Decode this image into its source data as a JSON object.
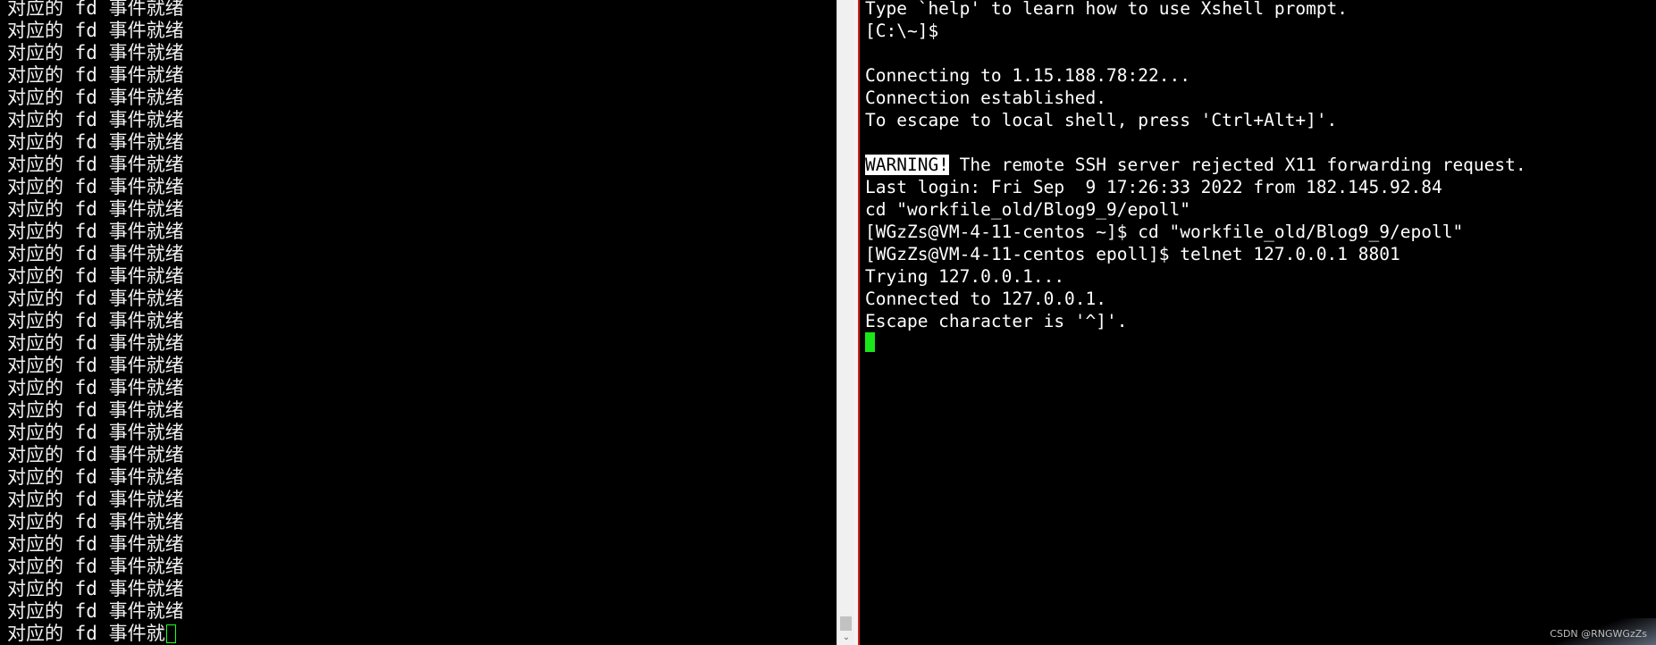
{
  "left_terminal": {
    "lines": [
      "对应的 fd 事件就绪",
      "对应的 fd 事件就绪",
      "对应的 fd 事件就绪",
      "对应的 fd 事件就绪",
      "对应的 fd 事件就绪",
      "对应的 fd 事件就绪",
      "对应的 fd 事件就绪",
      "对应的 fd 事件就绪",
      "对应的 fd 事件就绪",
      "对应的 fd 事件就绪",
      "对应的 fd 事件就绪",
      "对应的 fd 事件就绪",
      "对应的 fd 事件就绪",
      "对应的 fd 事件就绪",
      "对应的 fd 事件就绪",
      "对应的 fd 事件就绪",
      "对应的 fd 事件就绪",
      "对应的 fd 事件就绪",
      "对应的 fd 事件就绪",
      "对应的 fd 事件就绪",
      "对应的 fd 事件就绪",
      "对应的 fd 事件就绪",
      "对应的 fd 事件就绪",
      "对应的 fd 事件就绪",
      "对应的 fd 事件就绪",
      "对应的 fd 事件就绪",
      "对应的 fd 事件就绪",
      "对应的 fd 事件就绪"
    ],
    "last_line": "对应的 fd 事件就"
  },
  "right_terminal": {
    "line_0": "Type `help' to learn how to use Xshell prompt.",
    "prompt_local": "[C:\\~]$",
    "line_2": "",
    "line_3": "Connecting to 1.15.188.78:22...",
    "line_4": "Connection established.",
    "line_5": "To escape to local shell, press 'Ctrl+Alt+]'.",
    "line_6": "",
    "warning_badge": "WARNING!",
    "warning_text": " The remote SSH server rejected X11 forwarding request.",
    "line_8": "Last login: Fri Sep  9 17:26:33 2022 from 182.145.92.84",
    "line_9": "cd \"workfile_old/Blog9_9/epoll\"",
    "line_10": "[WGzZs@VM-4-11-centos ~]$ cd \"workfile_old/Blog9_9/epoll\"",
    "line_11": "[WGzZs@VM-4-11-centos epoll]$ telnet 127.0.0.1 8801",
    "line_12": "Trying 127.0.0.1...",
    "line_13": "Connected to 127.0.0.1.",
    "line_14": "Escape character is '^]'."
  },
  "scrollbar": {
    "arrow_glyph": "⌄"
  },
  "watermark": "CSDN @RNGWGzZs",
  "colors": {
    "background": "#000000",
    "text": "#ffffff",
    "prompt_green": "#3cff3c",
    "cursor_green": "#19e619",
    "divider_red": "#d02020"
  }
}
